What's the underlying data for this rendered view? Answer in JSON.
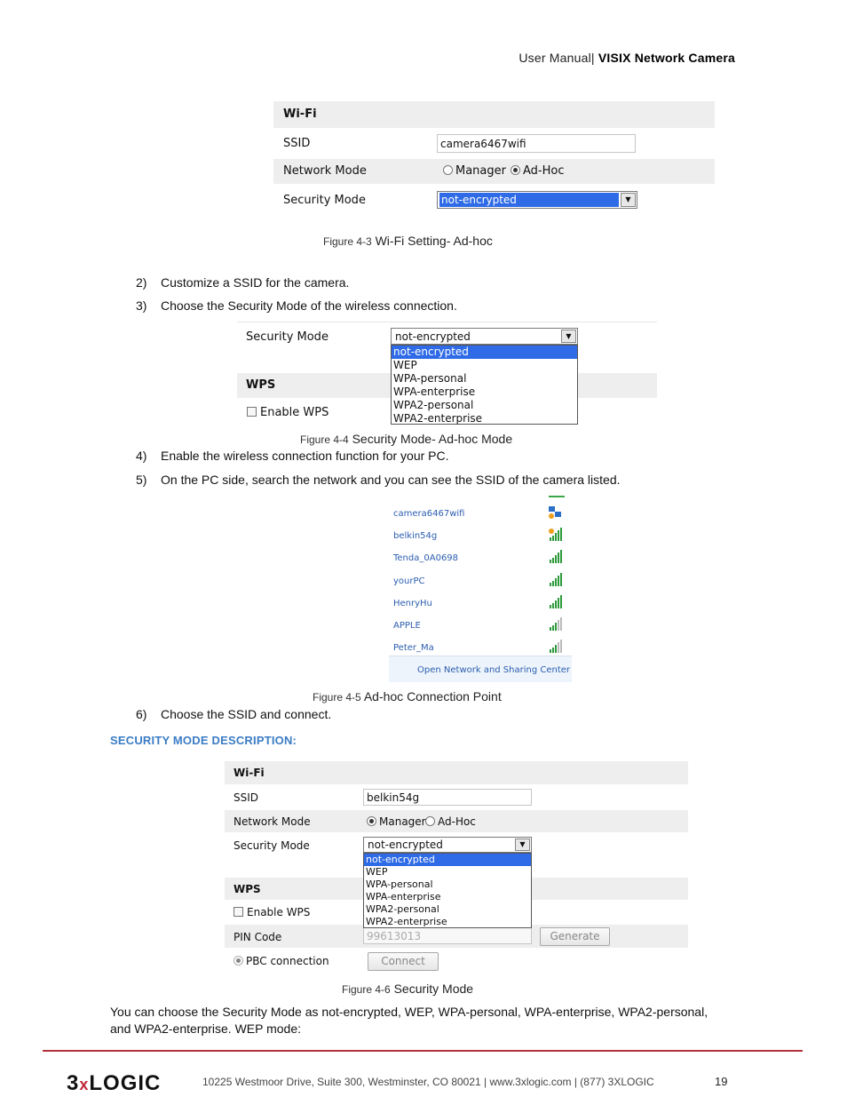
{
  "header": {
    "prefix": "User Manual|",
    "product": "VISIX Network Camera"
  },
  "fig43": {
    "title": "Wi-Fi",
    "ssid_label": "SSID",
    "ssid_value": "camera6467wifi",
    "network_mode_label": "Network Mode",
    "manager_label": "Manager",
    "adhoc_label": "Ad-Hoc",
    "security_mode_label": "Security Mode",
    "security_value": "not-encrypted",
    "caption_num": "Figure 4-3",
    "caption_text": "Wi-Fi Setting- Ad-hoc"
  },
  "steps_a": [
    {
      "num": "2)",
      "text": "Customize a SSID for the camera."
    },
    {
      "num": "3)",
      "text": "Choose the Security Mode of the wireless connection."
    }
  ],
  "fig44": {
    "security_mode_label": "Security Mode",
    "security_value": "not-encrypted",
    "wps_title": "WPS",
    "enable_wps": "Enable WPS",
    "options": [
      "not-encrypted",
      "WEP",
      "WPA-personal",
      "WPA-enterprise",
      "WPA2-personal",
      "WPA2-enterprise"
    ],
    "caption_num": "Figure 4-4",
    "caption_text": "Security Mode- Ad-hoc Mode"
  },
  "steps_b": [
    {
      "num": "4)",
      "text": "Enable the wireless connection function for your PC."
    },
    {
      "num": "5)",
      "text": "On the PC side, search the network and you can see the SSID of the camera listed."
    }
  ],
  "fig45": {
    "networks": [
      "camera6467wifi",
      "belkin54g",
      "Tenda_0A0698",
      "yourPC",
      "HenryHu",
      "APPLE",
      "Peter_Ma"
    ],
    "footer_link": "Open Network and Sharing Center",
    "caption_num": "Figure 4-5",
    "caption_text": "Ad-hoc Connection Point"
  },
  "step6": {
    "num": "6)",
    "text": "Choose the SSID and connect."
  },
  "section_heading": "SECURITY MODE DESCRIPTION:",
  "fig46": {
    "title": "Wi-Fi",
    "ssid_label": "SSID",
    "ssid_value": "belkin54g",
    "network_mode_label": "Network Mode",
    "manager_label": "Manager",
    "adhoc_label": "Ad-Hoc",
    "security_mode_label": "Security Mode",
    "security_value": "not-encrypted",
    "options": [
      "not-encrypted",
      "WEP",
      "WPA-personal",
      "WPA-enterprise",
      "WPA2-personal",
      "WPA2-enterprise"
    ],
    "wps_title": "WPS",
    "enable_wps": "Enable WPS",
    "pin_label": "PIN Code",
    "pin_value": "99613013",
    "generate": "Generate",
    "pbc_label": "PBC connection",
    "connect": "Connect",
    "caption_num": "Figure 4-6",
    "caption_text": "Security Mode"
  },
  "paragraph": "You can choose the Security Mode as not-encrypted, WEP, WPA-personal, WPA-enterprise, WPA2-personal, and WPA2-enterprise. WEP mode:",
  "footer": {
    "logo_a": "3",
    "logo_x": "x",
    "logo_b": "LOGIC",
    "address": "10225 Westmoor Drive, Suite 300, Westminster, CO 80021 | www.3xlogic.com | (877) 3XLOGIC",
    "page": "19"
  },
  "colors": {
    "accent_red": "#b2313b",
    "heading_blue": "#3b7cc5",
    "select_blue": "#2f6be6",
    "link_blue": "#2a5db0"
  }
}
